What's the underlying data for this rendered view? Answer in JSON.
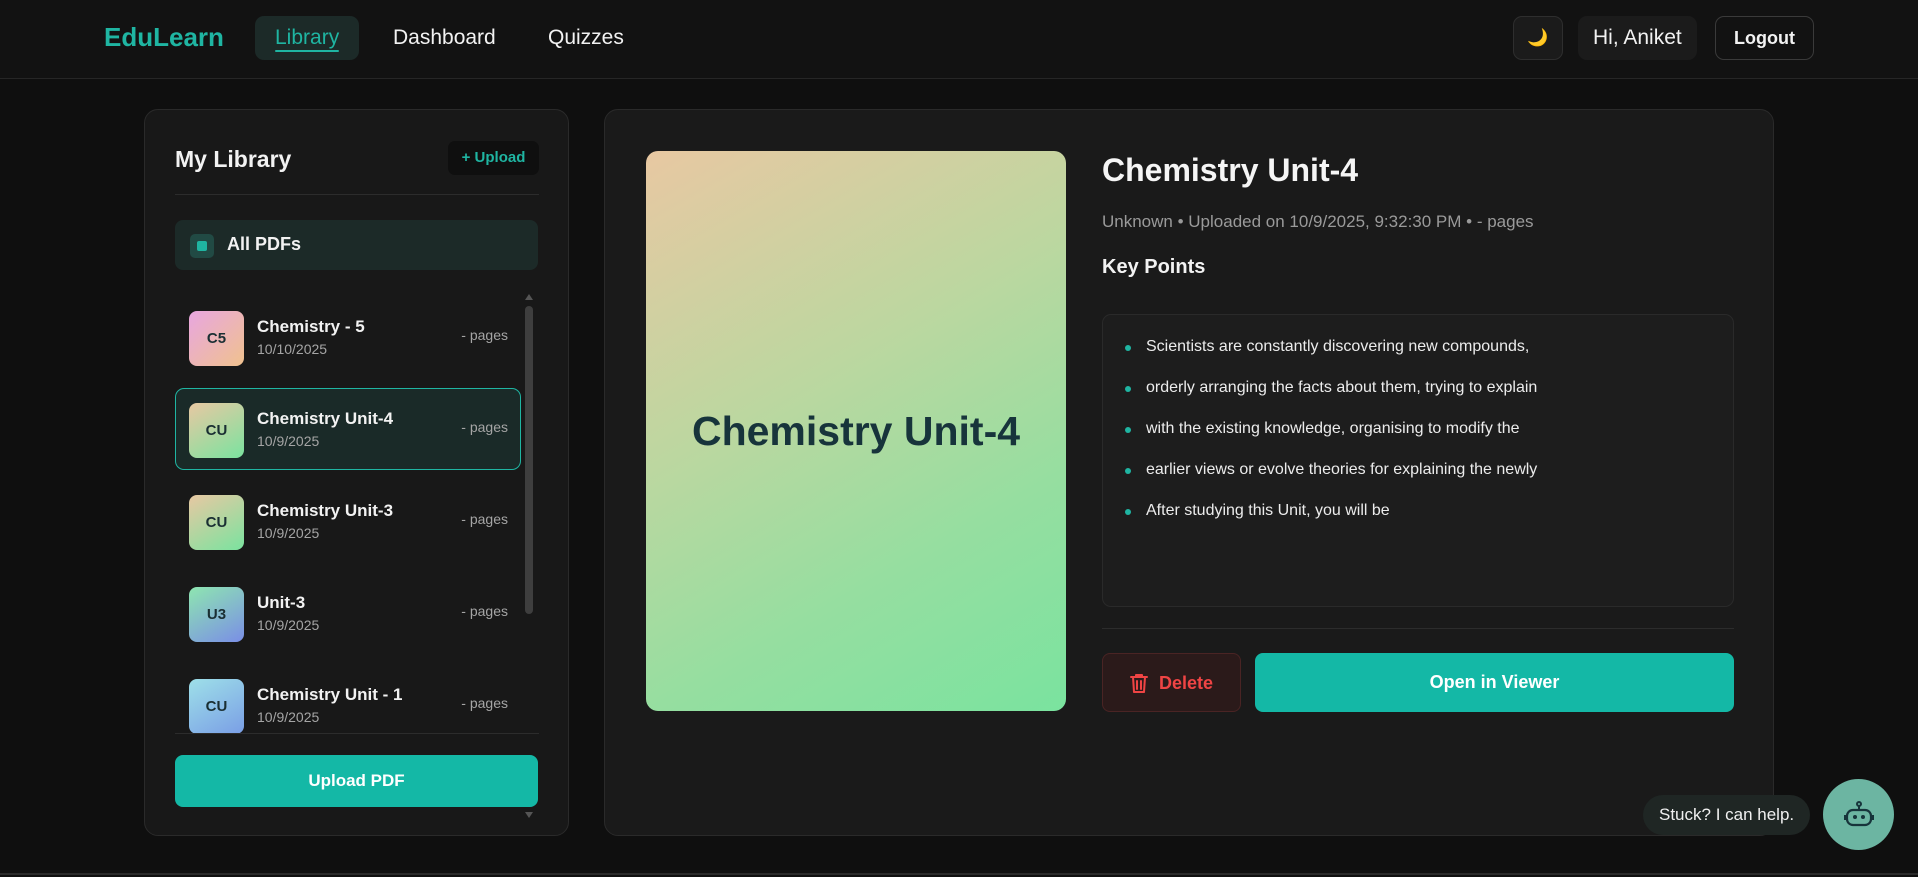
{
  "nav": {
    "brand": "EduLearn",
    "items": [
      {
        "label": "Library",
        "active": true
      },
      {
        "label": "Dashboard",
        "active": false
      },
      {
        "label": "Quizzes",
        "active": false
      }
    ],
    "theme_icon": "moon-icon",
    "theme_glyph": "🌙",
    "greeting": "Hi, Aniket",
    "logout_label": "Logout"
  },
  "library": {
    "title": "My Library",
    "upload_small_label": "+ Upload",
    "all_pdfs_label": "All PDFs",
    "items": [
      {
        "initials": "C5",
        "name": "Chemistry - 5",
        "date": "10/10/2025",
        "pages": "- pages",
        "selected": false
      },
      {
        "initials": "CU",
        "name": "Chemistry Unit-4",
        "date": "10/9/2025",
        "pages": "- pages",
        "selected": true
      },
      {
        "initials": "CU",
        "name": "Chemistry Unit-3",
        "date": "10/9/2025",
        "pages": "- pages",
        "selected": false
      },
      {
        "initials": "U3",
        "name": "Unit-3",
        "date": "10/9/2025",
        "pages": "- pages",
        "selected": false
      },
      {
        "initials": "CU",
        "name": "Chemistry Unit - 1",
        "date": "10/9/2025",
        "pages": "- pages",
        "selected": false
      }
    ],
    "upload_button_label": "Upload PDF"
  },
  "detail": {
    "cover_title": "Chemistry Unit-4",
    "title": "Chemistry Unit-4",
    "meta": "Unknown • Uploaded on 10/9/2025, 9:32:30 PM • - pages",
    "key_points_heading": "Key Points",
    "key_points": [
      "Scientists are constantly discovering new compounds,",
      "orderly arranging the facts about them, trying to explain",
      "with the existing knowledge, organising to modify the",
      "earlier views or evolve theories for explaining the newly",
      "After studying this Unit, you will be"
    ],
    "delete_label": "Delete",
    "open_label": "Open in Viewer"
  },
  "help": {
    "bubble_text": "Stuck? I can help.",
    "icon": "robot-icon"
  },
  "colors": {
    "accent": "#14b8a6",
    "danger": "#ef4444",
    "background": "#0f0f0f",
    "panel": "#1a1a1a"
  }
}
